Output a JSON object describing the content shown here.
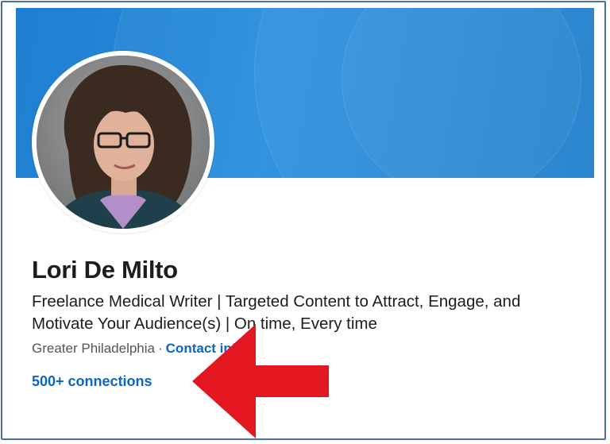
{
  "profile": {
    "name": "Lori De Milto",
    "headline": "Freelance Medical Writer | Targeted Content to Attract, Engage, and Motivate Your Audience(s) | On time, Every time",
    "location": "Greater Philadelphia",
    "separator": "·",
    "contact_info_label": "Contact info",
    "connections_label": "500+ connections"
  },
  "colors": {
    "banner_blue": "#1f7ed0",
    "link_blue": "#0a66c2",
    "annotation_arrow_red": "#e3171f",
    "frame_border": "#4a6fa5"
  },
  "icons": {
    "annotation": "red-arrow-left-icon"
  }
}
